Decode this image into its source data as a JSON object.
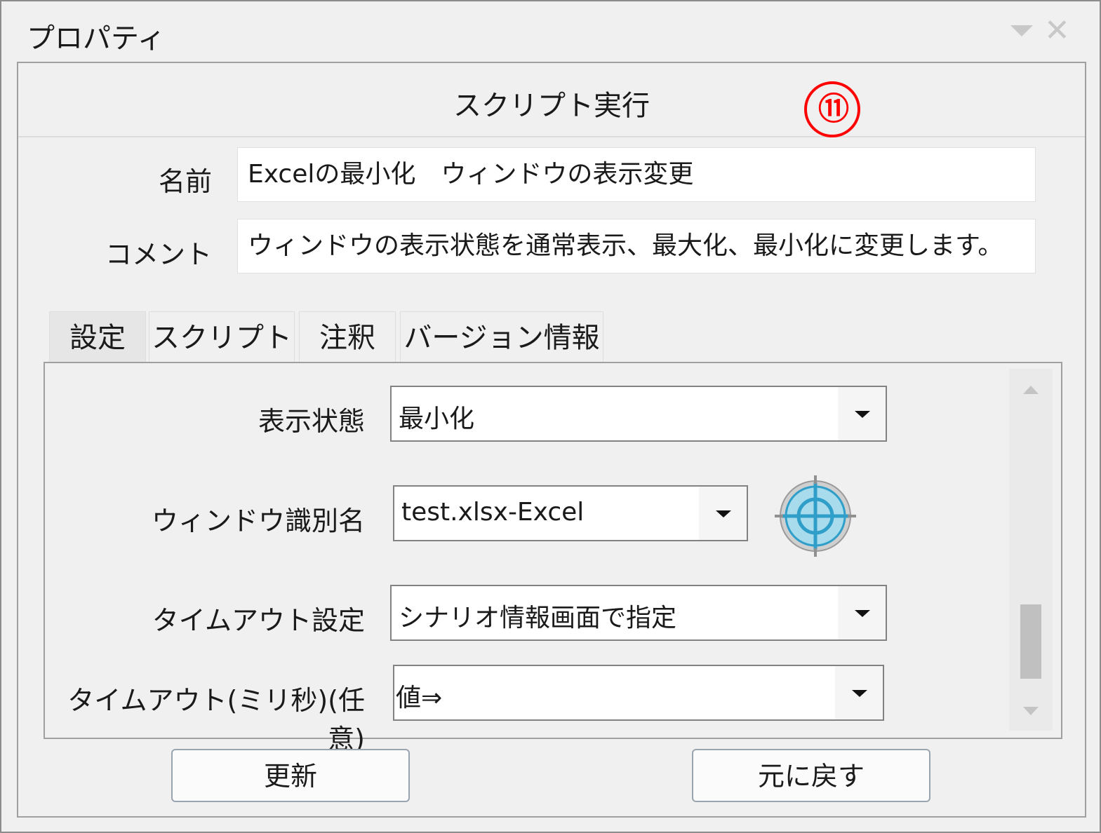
{
  "window": {
    "title": "プロパティ"
  },
  "panel": {
    "title": "スクリプト実行",
    "marker": "⑪"
  },
  "fields": {
    "name_label": "名前",
    "name_value": "Excelの最小化　ウィンドウの表示変更",
    "comment_label": "コメント",
    "comment_value": "ウィンドウの表示状態を通常表示、最大化、最小化に変更します。"
  },
  "tabs": [
    {
      "label": "設定",
      "active": true
    },
    {
      "label": "スクリプト",
      "active": false
    },
    {
      "label": "注釈",
      "active": false
    },
    {
      "label": "バージョン情報",
      "active": false
    }
  ],
  "settings": {
    "display_state_label": "表示状態",
    "display_state_value": "最小化",
    "window_id_label": "ウィンドウ識別名",
    "window_id_value": "test.xlsx-Excel",
    "timeout_setting_label": "タイムアウト設定",
    "timeout_setting_value": "シナリオ情報画面で指定",
    "timeout_ms_label": "タイムアウト(ミリ秒)(任意)",
    "timeout_ms_value": "値⇒"
  },
  "buttons": {
    "update": "更新",
    "revert": "元に戻す"
  },
  "colors": {
    "marker": "#ff0000",
    "target_fill": "#a8dcec",
    "target_stroke": "#2f9ec9"
  }
}
